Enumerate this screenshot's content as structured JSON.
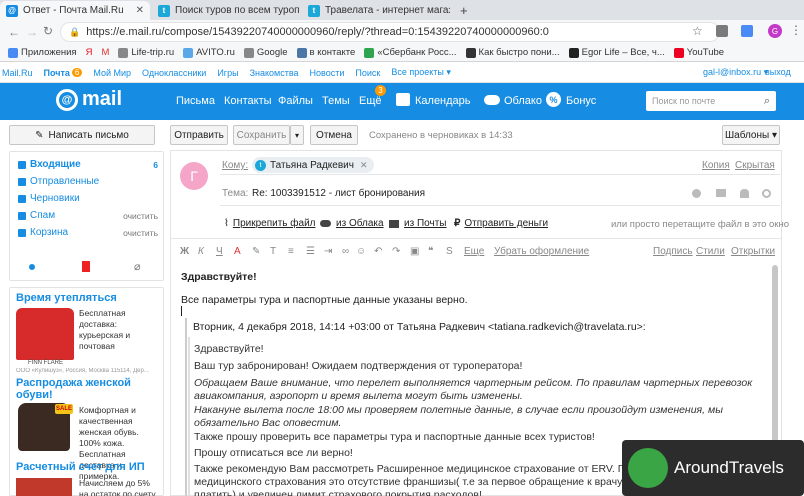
{
  "browser": {
    "tabs": [
      {
        "title": "Ответ - Почта Mail.Ru",
        "active": true
      },
      {
        "title": "Поиск туров по всем туропер"
      },
      {
        "title": "Травелата - интернет магази"
      }
    ],
    "url": "https://e.mail.ru/compose/15439220740000000960/reply/?thread=0:15439220740000000960:0",
    "bookmarks": [
      "Приложения",
      "Я",
      "М",
      "Life-trip.ru",
      "AVITO.ru",
      "Google",
      "в контакте",
      "«Сбербанк Росс...",
      "Как быстро пони...",
      "Egor Life – Все, ч...",
      "YouTube"
    ]
  },
  "portal": {
    "items": [
      "Mail.Ru",
      "Почта",
      "Мой Мир",
      "Одноклассники",
      "Игры",
      "Знакомства",
      "Новости",
      "Поиск",
      "Все проекты ▾"
    ],
    "mail_badge": "6",
    "user": "gal-l@inbox.ru ▾",
    "logout": "выход"
  },
  "header": {
    "logo": "mail",
    "nav": [
      "Письма",
      "Контакты",
      "Файлы",
      "Темы",
      "Ещё"
    ],
    "more_badge": "3",
    "calendar": "Календарь",
    "cloud": "Облако",
    "bonus": "Бонус",
    "search_placeholder": "Поиск по почте"
  },
  "actions": {
    "compose": "Написать письмо",
    "send": "Отправить",
    "save": "Сохранить",
    "cancel": "Отмена",
    "saved_status": "Сохранено в черновиках в 14:33",
    "templates": "Шаблоны ▾"
  },
  "sidebar": {
    "folders": [
      {
        "label": "Входящие",
        "count": "6",
        "bold": true
      },
      {
        "label": "Отправленные",
        "count": ""
      },
      {
        "label": "Черновики",
        "count": ""
      },
      {
        "label": "Спам",
        "count": "очистить"
      },
      {
        "label": "Корзина",
        "count": "очистить"
      }
    ],
    "promos": [
      {
        "title": "Время утепляться",
        "text": "Бесплатная доставка: курьерская и почтовая",
        "footer": "ООО «Кулишуз», Россия, Москва 115114, Дер..."
      },
      {
        "title": "Распродажа женской обуви!",
        "text": "Комфортная и качественная женская обувь. 100% кожа. Бесплатная доставка и примерка."
      },
      {
        "title": "Расчетный счет для ИП",
        "text": "Начисляем до 5% на остаток по счету"
      }
    ],
    "brand_label": "FINN FLARE"
  },
  "compose": {
    "to_label": "Кому:",
    "recipient": "Татьяна Радкевич",
    "copy": "Копия",
    "hidden_copy": "Скрытая",
    "subject_label": "Тема:",
    "subject": "Re: 1003391512 - лист бронирования",
    "attach": "Прикрепить файл",
    "from_cloud": "из Облака",
    "from_mail": "из Почты",
    "send_money": "Отправить деньги",
    "drag_hint": "или просто перетащите файл в это окно",
    "format_more": "Еще",
    "remove_format": "Убрать оформление",
    "signature": "Подпись",
    "styles": "Стили",
    "postcards": "Открытки",
    "body_lines": [
      "Здравствуйте!",
      "Все параметры тура и паспортные данные указаны верно."
    ],
    "quote_header": "Вторник, 4 декабря 2018, 14:14 +03:00 от Татьяна Радкевич <tatiana.radkevich@travelata.ru>:",
    "quote_lines": [
      {
        "text": "Здравствуйте!",
        "italic": false
      },
      {
        "text": "Ваш тур забронирован! Ожидаем подтверждения от туроператора!",
        "italic": false
      },
      {
        "text": "Обращаем Ваше внимание, что перелет выполняется чартерным рейсом. По правилам чартерных перевозок авиакомпания, аэропорт и время вылета могут быть изменены.",
        "italic": true
      },
      {
        "text": "Накануне вылета после 18:00 мы проверяем полетные данные, в случае если произойдут изменения, мы обязательно Вас оповестим.",
        "italic": true
      },
      {
        "text": "Также прошу проверить все параметры тура и паспортные данные всех туристов!",
        "italic": false
      },
      {
        "text": "Прошу отписаться все ли верно!",
        "italic": false
      },
      {
        "text": "Также рекомендую Вам рассмотреть Расширенное медицинское страхование от ERV. Главное преимущество медицинского страхования это отсутствие франшизы( т.е за первое обращение к врачу Вам не надо будет платить) и увеличен лимит страхового покрытия расходов!",
        "italic": false
      }
    ]
  },
  "watermark": "AroundTravels",
  "avatar_letter": "Г",
  "colors": {
    "brand": "#168de2",
    "chrome": "#dee1e6"
  }
}
